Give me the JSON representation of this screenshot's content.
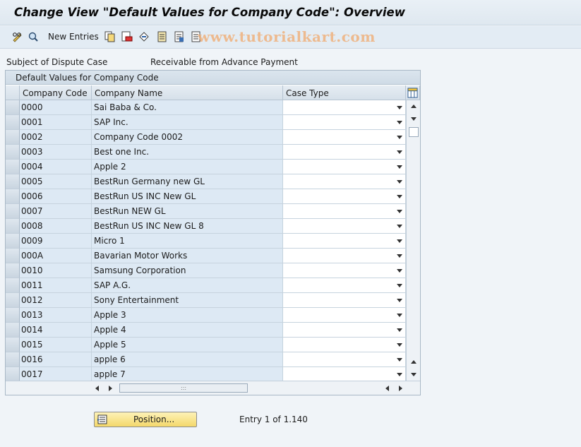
{
  "window": {
    "title": "Change View \"Default Values for Company Code\": Overview"
  },
  "toolbar": {
    "new_entries_label": "New Entries",
    "icons": [
      "edit-glasses-icon",
      "toggle-display-icon",
      "copy-icon",
      "delete-icon",
      "undo-icon",
      "select-all-icon",
      "select-block-icon",
      "deselect-all-icon"
    ]
  },
  "watermark": "www.tutorialkart.com",
  "subject": {
    "label": "Subject of Dispute Case",
    "value": "Receivable from Advance Payment"
  },
  "table": {
    "title": "Default Values for Company Code",
    "columns": {
      "code": "Company Code",
      "name": "Company Name",
      "type": "Case Type"
    },
    "rows": [
      {
        "code": "0000",
        "name": "Sai Baba & Co.",
        "type": ""
      },
      {
        "code": "0001",
        "name": "SAP Inc.",
        "type": ""
      },
      {
        "code": "0002",
        "name": "Company Code 0002",
        "type": ""
      },
      {
        "code": "0003",
        "name": "Best one Inc.",
        "type": ""
      },
      {
        "code": "0004",
        "name": "Apple 2",
        "type": ""
      },
      {
        "code": "0005",
        "name": "BestRun Germany new GL",
        "type": ""
      },
      {
        "code": "0006",
        "name": "BestRun US INC New GL",
        "type": ""
      },
      {
        "code": "0007",
        "name": "BestRun NEW GL",
        "type": ""
      },
      {
        "code": "0008",
        "name": "BestRun US INC New GL 8",
        "type": ""
      },
      {
        "code": "0009",
        "name": "Micro 1",
        "type": ""
      },
      {
        "code": "000A",
        "name": "Bavarian Motor Works",
        "type": ""
      },
      {
        "code": "0010",
        "name": "Samsung Corporation",
        "type": ""
      },
      {
        "code": "0011",
        "name": "SAP A.G.",
        "type": ""
      },
      {
        "code": "0012",
        "name": "Sony Entertainment",
        "type": ""
      },
      {
        "code": "0013",
        "name": "Apple 3",
        "type": ""
      },
      {
        "code": "0014",
        "name": "Apple 4",
        "type": ""
      },
      {
        "code": "0015",
        "name": "Apple 5",
        "type": ""
      },
      {
        "code": "0016",
        "name": "apple 6",
        "type": ""
      },
      {
        "code": "0017",
        "name": "apple 7",
        "type": ""
      }
    ]
  },
  "footer": {
    "position_button": "Position...",
    "entry_info": "Entry 1 of 1.140"
  }
}
